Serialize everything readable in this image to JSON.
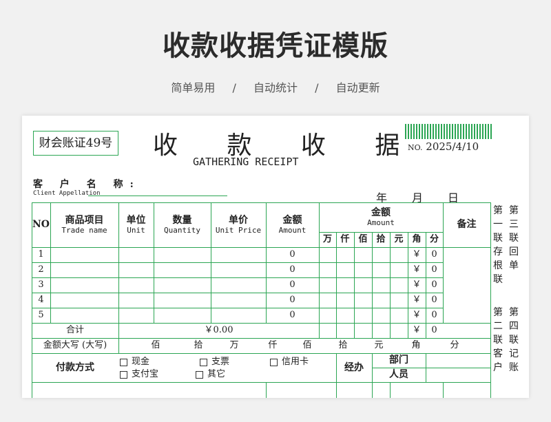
{
  "page": {
    "title": "收款收据凭证模版",
    "features": [
      "简单易用",
      "自动统计",
      "自动更新"
    ],
    "separator": "/"
  },
  "receipt": {
    "brand": "财会账证49号",
    "title": "收 款 收 据",
    "title_en": "GATHERING RECEIPT",
    "no_label": "NO.",
    "no_value": "2025/4/10",
    "client_label": "客 户 名 称:",
    "client_label_en": "Client Appellation",
    "date_labels": [
      "年",
      "月",
      "日"
    ],
    "headers": {
      "no": "NO",
      "item": "商品项目",
      "item_en": "Trade name",
      "unit": "单位",
      "unit_en": "Unit",
      "qty": "数量",
      "qty_en": "Quantity",
      "price": "单价",
      "price_en": "Unit Price",
      "amount": "金额",
      "amount_en": "Amount",
      "amount2": "金额",
      "amount2_en": "Amount",
      "remark": "备注",
      "digits": [
        "万",
        "仟",
        "佰",
        "拾",
        "元",
        "角",
        "分"
      ]
    },
    "rows": [
      {
        "no": "1",
        "amount": "0",
        "yen": "￥",
        "fen": "0"
      },
      {
        "no": "2",
        "amount": "0",
        "yen": "￥",
        "fen": "0"
      },
      {
        "no": "3",
        "amount": "0",
        "yen": "￥",
        "fen": "0"
      },
      {
        "no": "4",
        "amount": "0",
        "yen": "￥",
        "fen": "0"
      },
      {
        "no": "5",
        "amount": "0",
        "yen": "￥",
        "fen": "0"
      }
    ],
    "total": {
      "label": "合计",
      "value": "￥0.00",
      "yen": "￥",
      "fen": "0"
    },
    "uppercase": {
      "label": "金额大写 (大写)",
      "units": [
        "佰",
        "拾",
        "万",
        "仟",
        "佰",
        "拾",
        "元",
        "角",
        "分"
      ]
    },
    "payment": {
      "label": "付款方式",
      "options": [
        "现金",
        "支票",
        "信用卡",
        "支付宝",
        "其它"
      ],
      "handler_label": "经办",
      "dept_label": "部门",
      "person_label": "人员"
    },
    "copies": {
      "first": "第一联存根联",
      "second": "第二联客户",
      "third": "第三联回单",
      "fourth": "第四联记账"
    }
  }
}
